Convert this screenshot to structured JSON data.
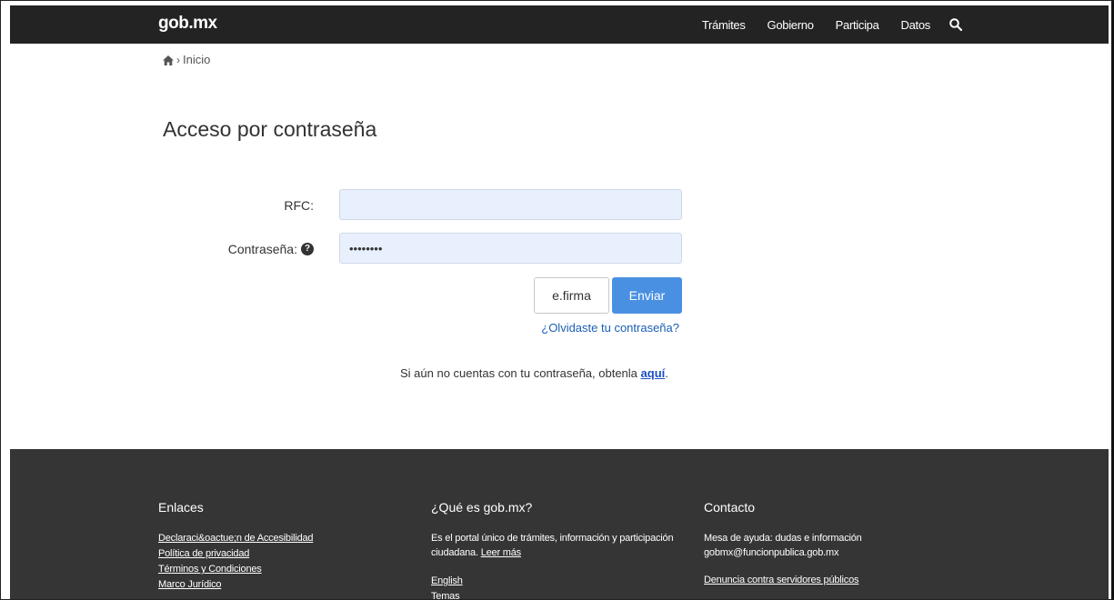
{
  "header": {
    "brand": "gob.mx",
    "nav": [
      "Trámites",
      "Gobierno",
      "Participa",
      "Datos"
    ],
    "search_icon": "search-icon"
  },
  "breadcrumb": {
    "home_icon": "home-icon",
    "separator": "›",
    "current": "Inicio"
  },
  "page": {
    "title": "Acceso por contraseña"
  },
  "form": {
    "rfc_label": "RFC:",
    "rfc_value": "",
    "password_label": "Contraseña:",
    "password_value": "••••••••",
    "help_icon": "question-circle-icon",
    "efirma_button": "e.firma",
    "submit_button": "Enviar",
    "forgot_link": "¿Olvidaste tu contraseña?",
    "signup_text": "Si aún no cuentas con tu contraseña, obtenla ",
    "signup_link": "aquí",
    "signup_end": "."
  },
  "footer": {
    "links_title": "Enlaces",
    "links": [
      "Declaraci&oactue;n de Accesibilidad",
      "Política de privacidad",
      "Términos y Condiciones",
      "Marco Jurídico"
    ],
    "about_title": "¿Qué es gob.mx?",
    "about_text": "Es el portal único de trámites, información y participación ciudadana.",
    "about_more": "Leer más",
    "about_links": [
      "English",
      "Temas"
    ],
    "contact_title": "Contacto",
    "contact_text": "Mesa de ayuda: dudas e información gobmx@funcionpublica.gob.mx",
    "contact_link": "Denuncia contra servidores públicos"
  },
  "colors": {
    "navbar": "#232323",
    "footer": "#353535",
    "primary_button": "#4a90e2",
    "input_fill": "#e8f0fe",
    "link": "#1a5fb4"
  }
}
